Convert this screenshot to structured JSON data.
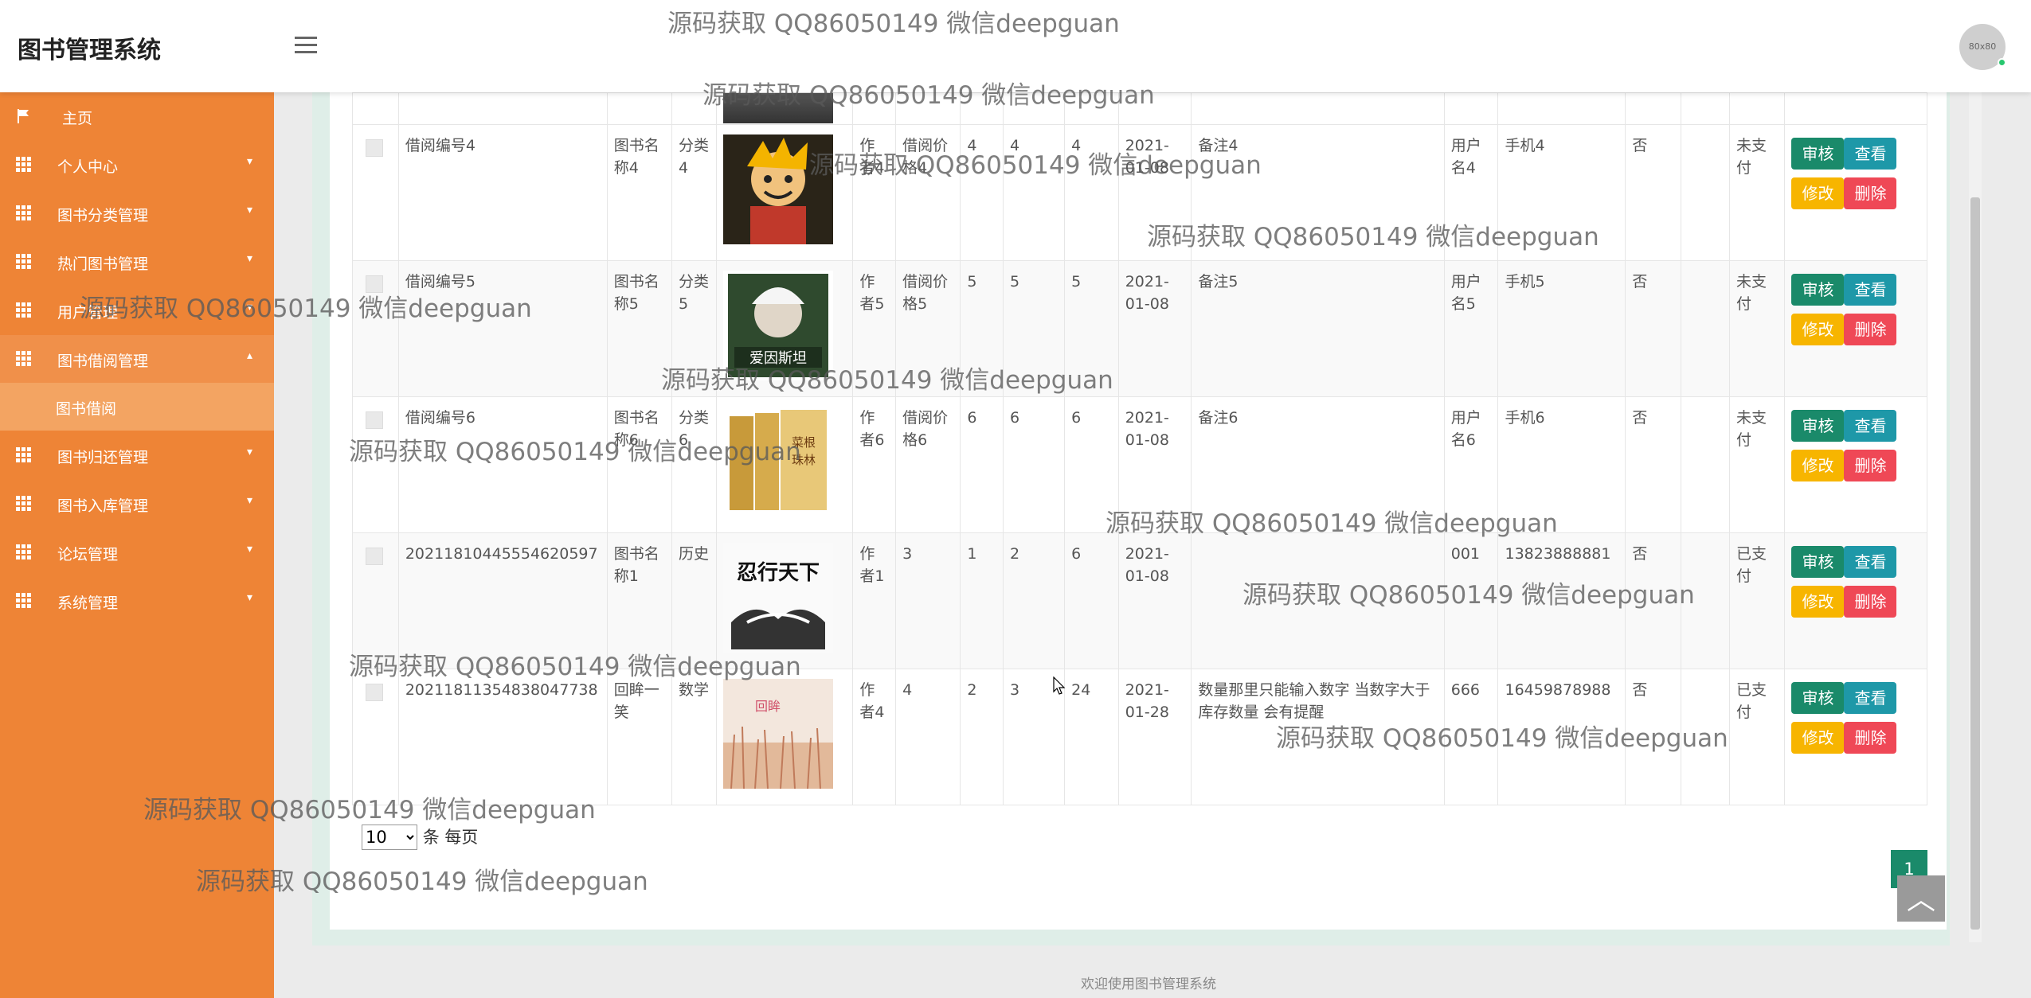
{
  "app": {
    "title": "图书管理系统",
    "avatar_text": "80x80",
    "footer": "欢迎使用图书管理系统"
  },
  "sidebar": {
    "items": [
      {
        "label": "主页",
        "icon": "flag-icon"
      },
      {
        "label": "个人中心",
        "icon": "grid-icon"
      },
      {
        "label": "图书分类管理",
        "icon": "grid-icon"
      },
      {
        "label": "热门图书管理",
        "icon": "grid-icon"
      },
      {
        "label": "用户管理",
        "icon": "grid-icon"
      },
      {
        "label": "图书借阅管理",
        "icon": "grid-icon",
        "expanded": true
      },
      {
        "label": "图书归还管理",
        "icon": "grid-icon"
      },
      {
        "label": "图书入库管理",
        "icon": "grid-icon"
      },
      {
        "label": "论坛管理",
        "icon": "grid-icon"
      },
      {
        "label": "系统管理",
        "icon": "grid-icon"
      }
    ],
    "submenu": {
      "label": "图书借阅"
    }
  },
  "table": {
    "rows": [
      {
        "borrow_no": "借阅编号4",
        "book_name": "图书名称4",
        "category": "分类4",
        "cover": "cover-manga",
        "author": "作者4",
        "price": "借阅价格4",
        "c1": "4",
        "c2": "4",
        "c3": "4",
        "date": "2021-01-08",
        "remark": "备注4",
        "username": "用户名4",
        "phone": "手机4",
        "flag": "否",
        "blank": "",
        "pay": "未支付"
      },
      {
        "borrow_no": "借阅编号5",
        "book_name": "图书名称5",
        "category": "分类5",
        "cover": "cover-einstein",
        "author": "作者5",
        "price": "借阅价格5",
        "c1": "5",
        "c2": "5",
        "c3": "5",
        "date": "2021-01-08",
        "remark": "备注5",
        "username": "用户名5",
        "phone": "手机5",
        "flag": "否",
        "blank": "",
        "pay": "未支付"
      },
      {
        "borrow_no": "借阅编号6",
        "book_name": "图书名称6",
        "category": "分类6",
        "cover": "cover-caigen",
        "author": "作者6",
        "price": "借阅价格6",
        "c1": "6",
        "c2": "6",
        "c3": "6",
        "date": "2021-01-08",
        "remark": "备注6",
        "username": "用户名6",
        "phone": "手机6",
        "flag": "否",
        "blank": "",
        "pay": "未支付"
      },
      {
        "borrow_no": "20211810445554620597",
        "book_name": "图书名称1",
        "category": "历史",
        "cover": "cover-tianxia",
        "author": "作者1",
        "price": "3",
        "c1": "1",
        "c2": "2",
        "c3": "6",
        "date": "2021-01-08",
        "remark": "",
        "username": "001",
        "phone": "13823888881",
        "flag": "否",
        "blank": "",
        "pay": "已支付"
      },
      {
        "borrow_no": "20211811354838047738",
        "book_name": "回眸一笑",
        "category": "数学",
        "cover": "cover-field",
        "author": "作者4",
        "price": "4",
        "c1": "2",
        "c2": "3",
        "c3": "24",
        "date": "2021-01-28",
        "remark": "数量那里只能输入数字 当数字大于库存数量 会有提醒",
        "username": "666",
        "phone": "16459878988",
        "flag": "否",
        "blank": "",
        "pay": "已支付"
      }
    ],
    "actions": {
      "audit": "审核",
      "view": "查看",
      "edit": "修改",
      "delete": "删除"
    }
  },
  "pagination": {
    "page_size": "10",
    "per_page_label": "条 每页",
    "current_page": "1"
  },
  "watermark": "源码获取 QQ86050149 微信deepguan",
  "colors": {
    "sidebar": "#ee8436",
    "audit": "#1a8a6a",
    "view": "#1e98a8",
    "edit": "#f7b500",
    "delete": "#ef4856"
  }
}
